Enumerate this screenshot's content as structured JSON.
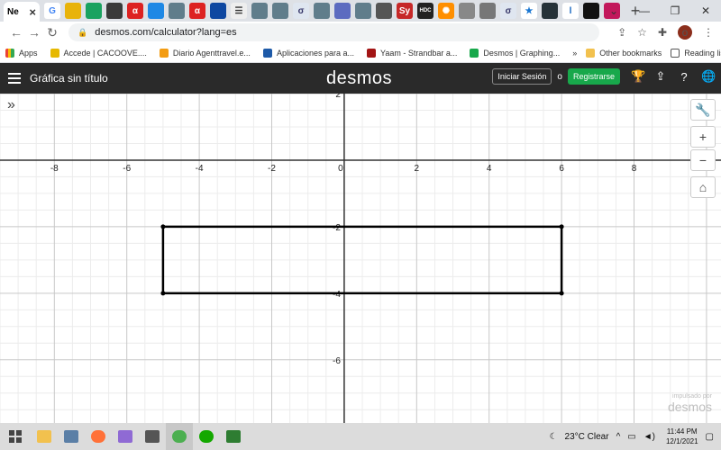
{
  "browser": {
    "active_tab_favicon": "Ne",
    "tabs": [
      {
        "name": "google-tab-icon",
        "label": "G",
        "color": "#ffffff",
        "text": "#4285f4"
      },
      {
        "name": "yellow-tab-icon",
        "label": "",
        "color": "#e8b30a",
        "text": "#fff"
      },
      {
        "name": "green-shield-tab-icon",
        "label": "",
        "color": "#1aa260",
        "text": "#fff"
      },
      {
        "name": "shield-tab-icon",
        "label": "",
        "color": "#3a3a3a",
        "text": "#fff"
      },
      {
        "name": "alpha-tab-icon",
        "label": "α",
        "color": "#d22",
        "text": "#fff"
      },
      {
        "name": "globe-tab-icon",
        "label": "",
        "color": "#1e88e5",
        "text": "#fff"
      },
      {
        "name": "hat-tab-icon",
        "label": "",
        "color": "#607d8b",
        "text": "#fff"
      },
      {
        "name": "alpha2-tab-icon",
        "label": "α",
        "color": "#d22",
        "text": "#fff"
      },
      {
        "name": "circle-tab-icon",
        "label": "",
        "color": "#0d47a1",
        "text": "#fff"
      },
      {
        "name": "list-tab-icon",
        "label": "☰",
        "color": "#eeeeee",
        "text": "#333"
      },
      {
        "name": "hat2-tab-icon",
        "label": "",
        "color": "#607d8b",
        "text": "#fff"
      },
      {
        "name": "hat3-tab-icon",
        "label": "",
        "color": "#607d8b",
        "text": "#fff"
      },
      {
        "name": "sigma-tab-icon",
        "label": "σ",
        "color": "#dfe6f0",
        "text": "#336"
      },
      {
        "name": "hat4-tab-icon",
        "label": "",
        "color": "#607d8b",
        "text": "#fff"
      },
      {
        "name": "moon-tab-icon",
        "label": "",
        "color": "#5c6bc0",
        "text": "#fff"
      },
      {
        "name": "hat5-tab-icon",
        "label": "",
        "color": "#607d8b",
        "text": "#fff"
      },
      {
        "name": "calc-tab-icon",
        "label": "",
        "color": "#555",
        "text": "#fff"
      },
      {
        "name": "sy-tab-icon",
        "label": "Sy",
        "color": "#c62828",
        "text": "#fff"
      },
      {
        "name": "hdc-tab-icon",
        "label": "HDC",
        "color": "#222",
        "text": "#fff"
      },
      {
        "name": "gear-tab-icon",
        "label": "✺",
        "color": "#ff8f00",
        "text": "#fff"
      },
      {
        "name": "grey-circle-tab-icon",
        "label": "",
        "color": "#888",
        "text": "#fff"
      },
      {
        "name": "grey-circle2-tab-icon",
        "label": "",
        "color": "#777",
        "text": "#fff"
      },
      {
        "name": "sigma2-tab-icon",
        "label": "σ",
        "color": "#dfe6f0",
        "text": "#336"
      },
      {
        "name": "star-tab-icon",
        "label": "★",
        "color": "#ffffff",
        "text": "#1976d2"
      },
      {
        "name": "hex-tab-icon",
        "label": "",
        "color": "#263238",
        "text": "#fff"
      },
      {
        "name": "l-tab-icon",
        "label": "l",
        "color": "#ffffff",
        "text": "#1565c0"
      },
      {
        "name": "flag-tab-icon",
        "label": "",
        "color": "#111",
        "text": "#fff"
      },
      {
        "name": "pen-tab-icon",
        "label": "",
        "color": "#c2185b",
        "text": "#fff"
      }
    ],
    "url": "desmos.com/calculator?lang=es"
  },
  "bookmarks": {
    "apps": "Apps",
    "items": [
      {
        "name": "bookmark-cacoove",
        "label": "Accede | CACOOVE....",
        "color": "#e6b800"
      },
      {
        "name": "bookmark-diario",
        "label": "Diario Agenttravel.e...",
        "color": "#f39c12"
      },
      {
        "name": "bookmark-aplicaciones",
        "label": "Aplicaciones para a...",
        "color": "#1e5aa8"
      },
      {
        "name": "bookmark-yaam",
        "label": "Yaam - Strandbar a...",
        "color": "#a31515"
      },
      {
        "name": "bookmark-desmos",
        "label": "Desmos | Graphing...",
        "color": "#18a84b"
      }
    ],
    "more": "»",
    "other": "Other bookmarks",
    "reading": "Reading list"
  },
  "desmos": {
    "graph_title": "Gráfica sin título",
    "logo": "desmos",
    "login": "Iniciar Sesión",
    "or": "o",
    "register": "Registrarse",
    "watermark_small": "impulsado por",
    "watermark_large": "desmos"
  },
  "graph": {
    "x_ticks": [
      "-8",
      "-6",
      "-4",
      "-2",
      "0",
      "2",
      "4",
      "6",
      "8"
    ],
    "y_ticks": [
      "2",
      "-2",
      "-4",
      "-6"
    ],
    "xlim": [
      -9.5,
      10.4
    ],
    "ylim": [
      -7.9,
      2.0
    ],
    "rectangle": {
      "x_min": -5,
      "x_max": 6,
      "y_min": -4,
      "y_max": -2
    },
    "colors": {
      "grid_minor": "#ececec",
      "grid_major": "#c8c8c8",
      "axis": "#333333",
      "shape": "#000000"
    }
  },
  "taskbar": {
    "weather": "23°C  Clear",
    "time": "11:44 PM",
    "date": "12/1/2021",
    "apps": [
      {
        "name": "file-explorer-icon",
        "color": "#f2c14e"
      },
      {
        "name": "media-player-icon",
        "color": "#5b7fa6"
      },
      {
        "name": "firefox-icon",
        "color": "#ff7139"
      },
      {
        "name": "drawing-app-icon",
        "color": "#8f6ad4"
      },
      {
        "name": "calculator-icon",
        "color": "#555"
      },
      {
        "name": "chrome-icon",
        "color": "#4caf50"
      },
      {
        "name": "upwork-icon",
        "color": "#14a800"
      },
      {
        "name": "notes-icon",
        "color": "#2e7d32"
      }
    ]
  }
}
